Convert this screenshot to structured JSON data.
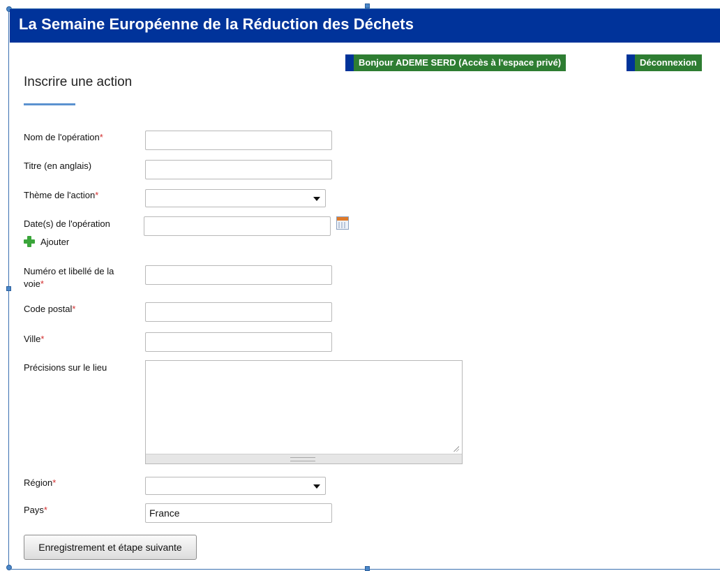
{
  "header": {
    "title": "La Semaine Européenne de la Réduction des Déchets"
  },
  "user_bar": {
    "greeting": "Bonjour ADEME SERD (Accès à l'espace privé)",
    "logout": "Déconnexion"
  },
  "page": {
    "heading": "Inscrire une action"
  },
  "required_marker": "*",
  "form": {
    "nom": {
      "label": "Nom de l'opération",
      "value": ""
    },
    "titre": {
      "label": "Titre (en anglais)",
      "value": ""
    },
    "theme": {
      "label": "Thème de l'action",
      "selected": ""
    },
    "dates": {
      "label": "Date(s) de l'opération",
      "value": "",
      "add_label": "Ajouter"
    },
    "voie": {
      "label_line1": "Numéro et libellé de la",
      "label_line2": "voie",
      "value": ""
    },
    "code_postal": {
      "label": "Code postal",
      "value": ""
    },
    "ville": {
      "label": "Ville",
      "value": ""
    },
    "precisions": {
      "label": "Précisions sur le lieu",
      "value": ""
    },
    "region": {
      "label": "Région",
      "selected": ""
    },
    "pays": {
      "label": "Pays",
      "value": "France"
    },
    "submit": "Enregistrement et étape suivante"
  },
  "colors": {
    "header_bg": "#00339a",
    "button_green": "#2e7d32",
    "required": "#d32f2f",
    "accent_rule": "#5b92cf"
  }
}
